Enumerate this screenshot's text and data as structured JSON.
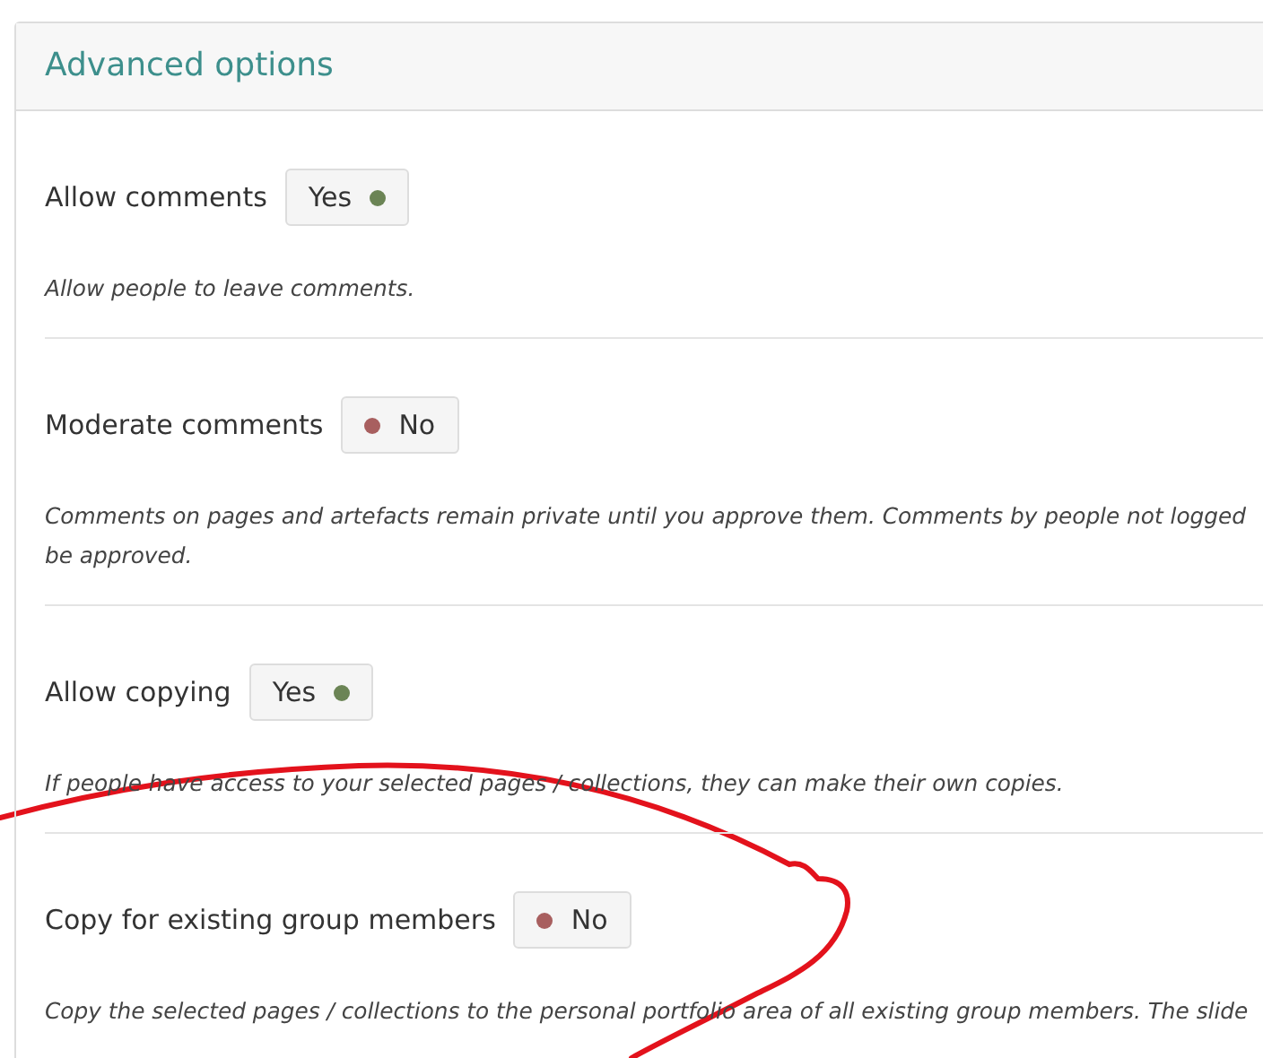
{
  "panel": {
    "title": "Advanced options"
  },
  "options": [
    {
      "label": "Allow comments",
      "value": "Yes",
      "on": true,
      "description": [
        "Allow people to leave comments."
      ]
    },
    {
      "label": "Moderate comments",
      "value": "No",
      "on": false,
      "description": [
        "Comments on pages and artefacts remain private until you approve them. Comments by people not logged",
        "be approved."
      ]
    },
    {
      "label": "Allow copying",
      "value": "Yes",
      "on": true,
      "description": [
        "If people have access to your selected pages / collections, they can make their own copies."
      ]
    },
    {
      "label": "Copy for existing group members",
      "value": "No",
      "on": false,
      "description": [
        "Copy the selected pages / collections to the personal portfolio area of all existing group members. The slide"
      ]
    }
  ]
}
